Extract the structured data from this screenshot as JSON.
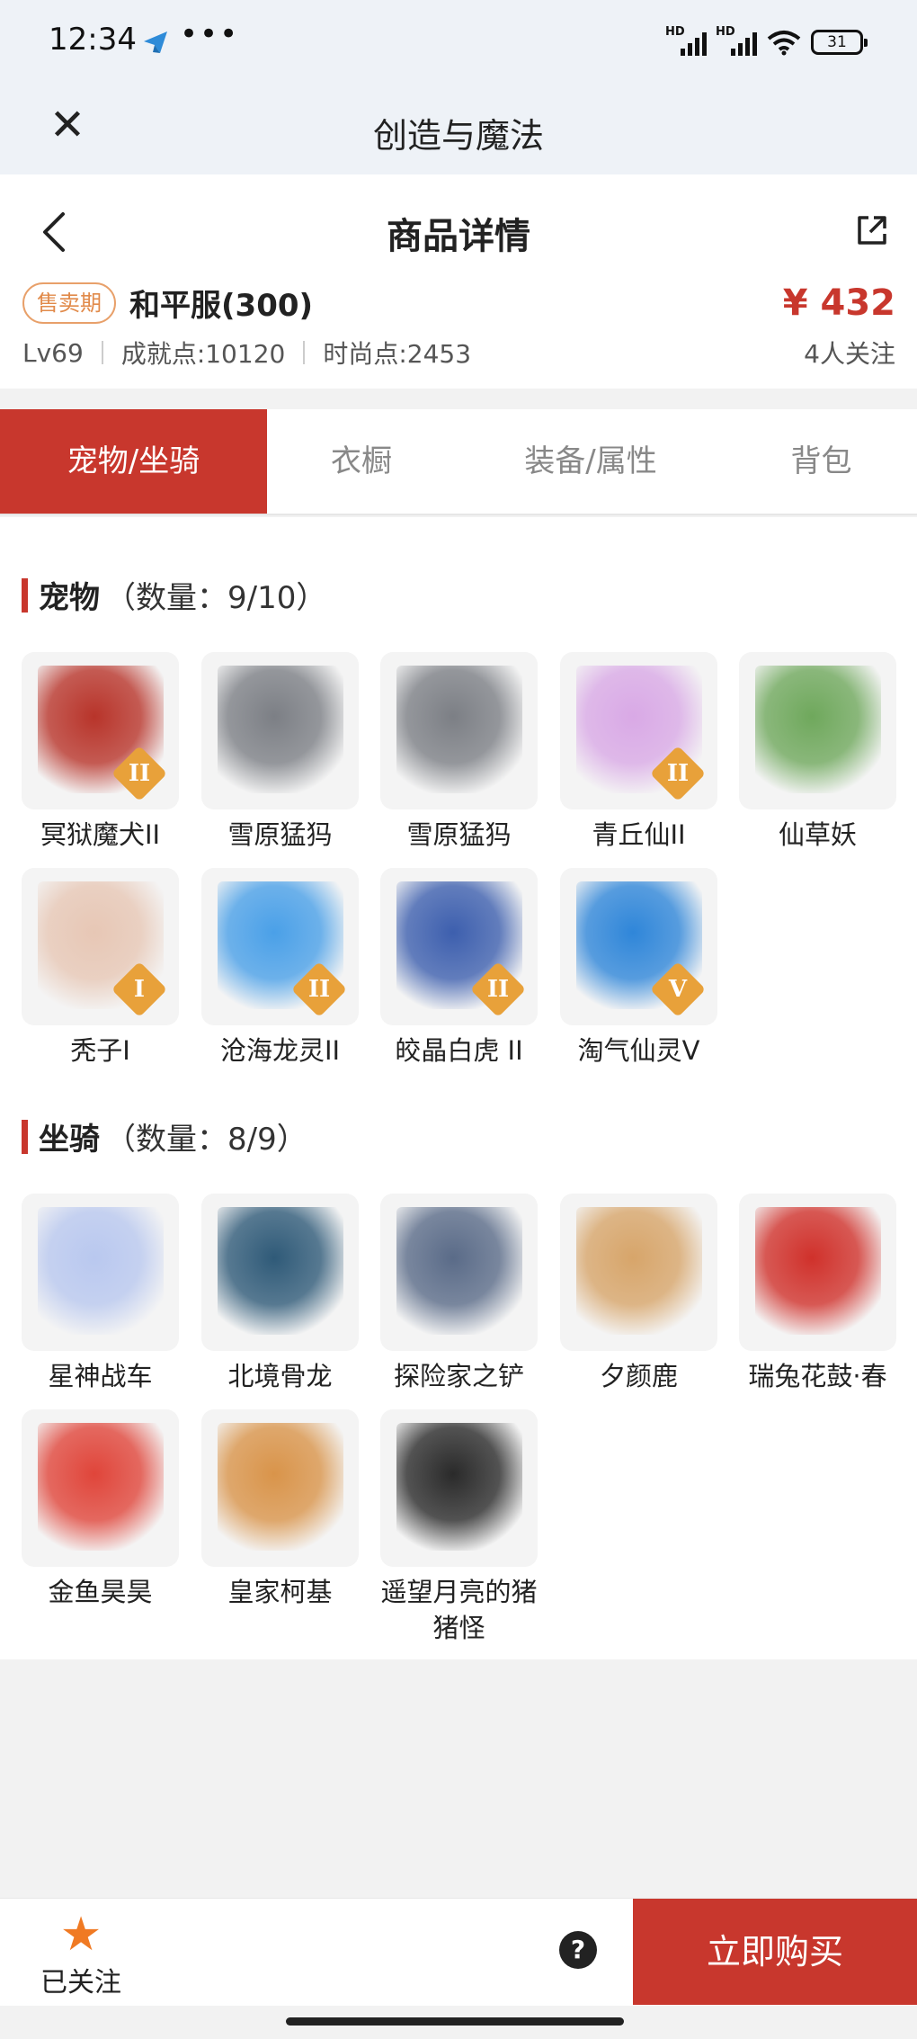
{
  "status_bar": {
    "time": "12:34",
    "dots": "•••",
    "battery": "31",
    "hd1": "HD",
    "hd2": "HD"
  },
  "app": {
    "title": "创造与魔法",
    "close_icon": "close-icon"
  },
  "header": {
    "title": "商品详情",
    "sale_badge": "售卖期",
    "product_name": "和平服(300)",
    "price": "¥ 432",
    "followers": "4人关注",
    "stats": [
      "Lv69",
      "成就点:10120",
      "时尚点:2453"
    ]
  },
  "tabs": [
    {
      "label": "宠物/坐骑",
      "active": true
    },
    {
      "label": "衣橱",
      "active": false
    },
    {
      "label": "装备/属性",
      "active": false
    },
    {
      "label": "背包",
      "active": false
    }
  ],
  "pets": {
    "title": "宠物",
    "count": "（数量：9/10）",
    "items": [
      {
        "name": "冥狱魔犬II",
        "tier": "II",
        "color": "#b8342a"
      },
      {
        "name": "雪原猛犸",
        "tier": "",
        "color": "#7c7f85"
      },
      {
        "name": "雪原猛犸",
        "tier": "",
        "color": "#7c7f85"
      },
      {
        "name": "青丘仙II",
        "tier": "II",
        "color": "#d9a9e6"
      },
      {
        "name": "仙草妖",
        "tier": "",
        "color": "#6fa85c"
      },
      {
        "name": "秃子I",
        "tier": "I",
        "color": "#e7c7b5"
      },
      {
        "name": "沧海龙灵II",
        "tier": "II",
        "color": "#4aa0e8"
      },
      {
        "name": "皎晶白虎 II",
        "tier": "II",
        "color": "#3d5fae"
      },
      {
        "name": "淘气仙灵V",
        "tier": "V",
        "color": "#2f86d9"
      }
    ]
  },
  "mounts": {
    "title": "坐骑",
    "count": "（数量：8/9）",
    "items": [
      {
        "name": "星神战车",
        "color": "#b9c8ef"
      },
      {
        "name": "北境骨龙",
        "color": "#2f5a78"
      },
      {
        "name": "探险家之铲",
        "color": "#5a6b88"
      },
      {
        "name": "夕颜鹿",
        "color": "#d7a56a"
      },
      {
        "name": "瑞兔花鼓·春",
        "color": "#d0312b"
      },
      {
        "name": "金鱼昊昊",
        "color": "#e0453a"
      },
      {
        "name": "皇家柯基",
        "color": "#d9944a"
      },
      {
        "name": "遥望月亮的猪猪怪",
        "color": "#2a2a2a"
      }
    ]
  },
  "bottom": {
    "follow_label": "已关注",
    "help": "?",
    "buy_label": "立即购买"
  }
}
